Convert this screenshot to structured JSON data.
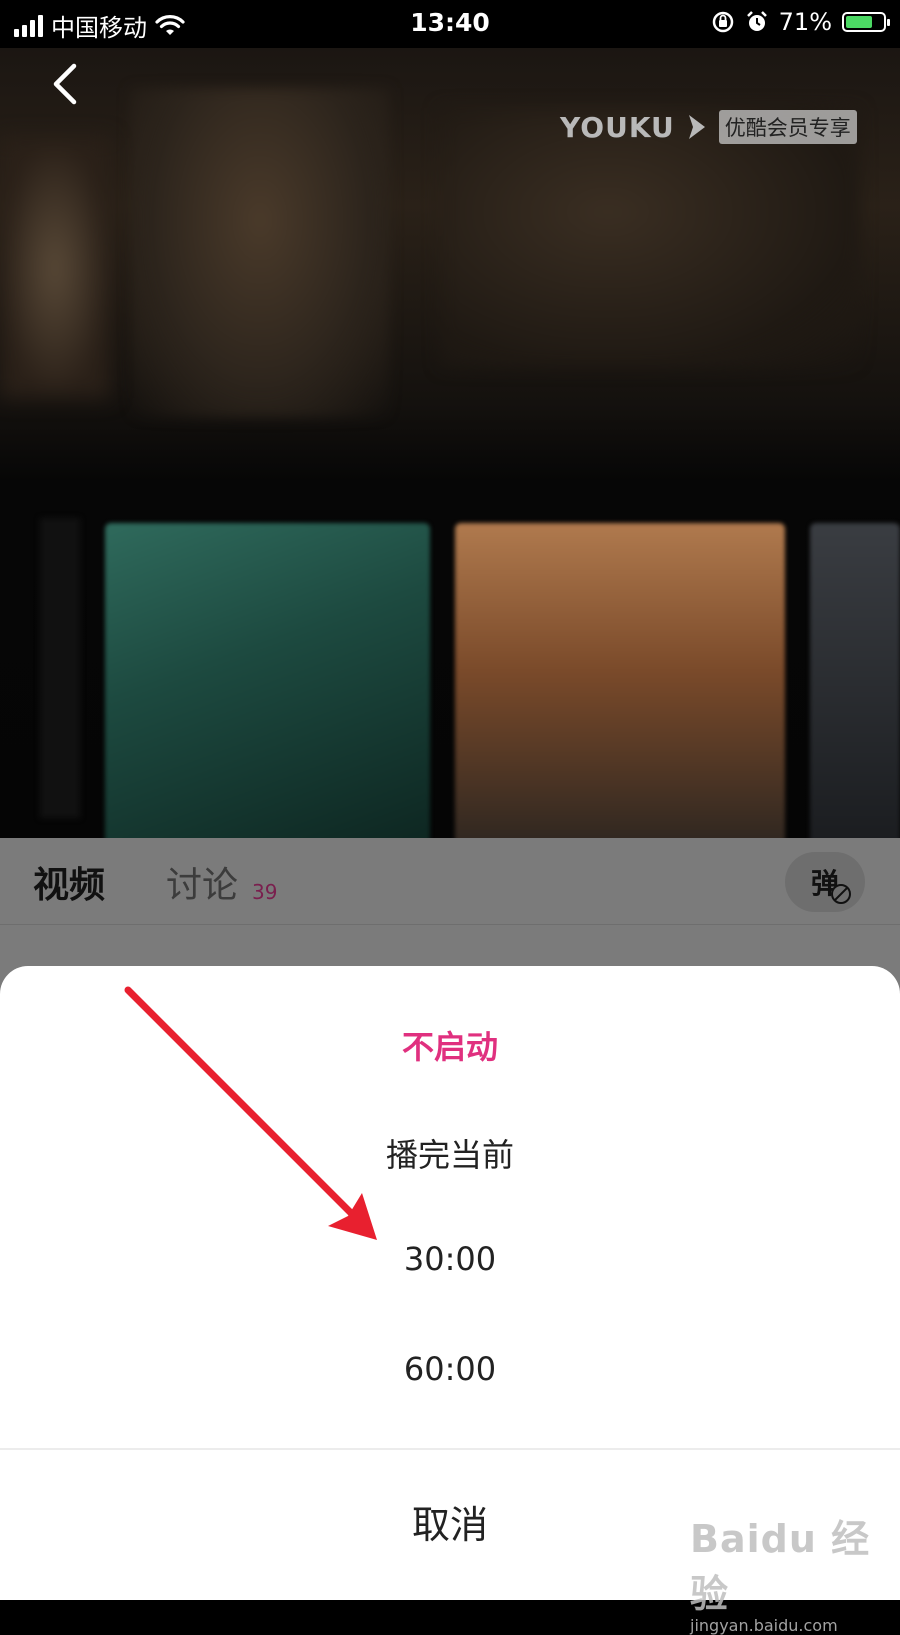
{
  "status_bar": {
    "carrier": "中国移动",
    "time": "13:40",
    "battery_percent": "71%",
    "battery_level": 0.71,
    "icons": [
      "signal-icon",
      "wifi-icon",
      "orientation-lock-icon",
      "alarm-icon",
      "battery-charging-icon"
    ]
  },
  "player": {
    "brand": "YOUKU",
    "badge": "优酷会员专享"
  },
  "tabs": {
    "video": "视频",
    "discuss": "讨论",
    "discuss_count": "39",
    "danmu": "弹"
  },
  "sheet": {
    "options": [
      "不启动",
      "播完当前",
      "30:00",
      "60:00"
    ],
    "selected_index": 0,
    "cancel": "取消"
  },
  "colors": {
    "accent": "#e0307f",
    "arrow": "#e8202f"
  },
  "watermark": {
    "main": "Baidu 经验",
    "sub": "jingyan.baidu.com"
  }
}
